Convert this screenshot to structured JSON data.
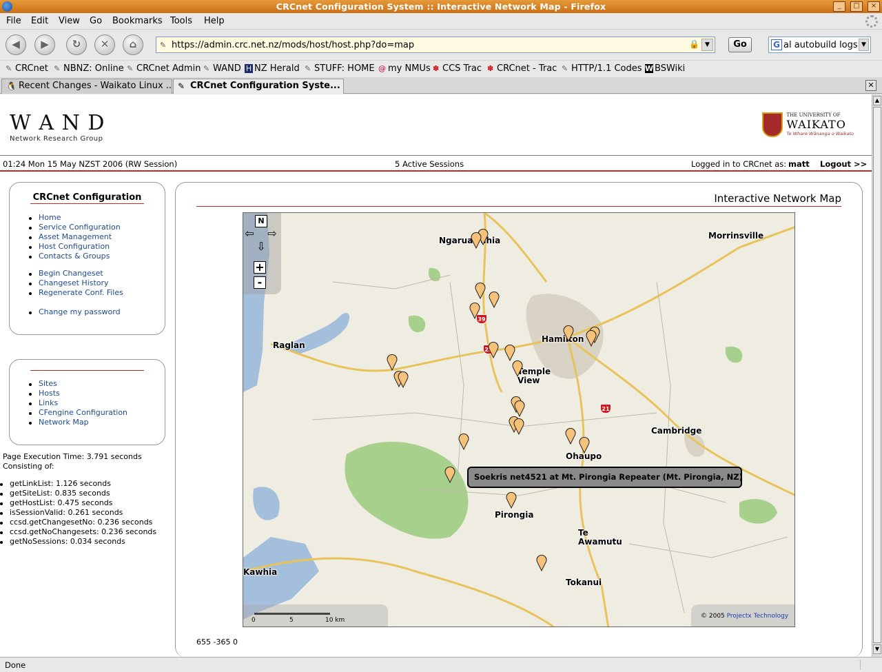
{
  "window": {
    "title": "CRCnet Configuration System :: Interactive Network Map - Firefox",
    "min_glyph": "_",
    "max_glyph": "□",
    "close_glyph": "×"
  },
  "menu": {
    "items": [
      {
        "label": "File"
      },
      {
        "label": "Edit"
      },
      {
        "label": "View"
      },
      {
        "label": "Go"
      },
      {
        "label": "Bookmarks"
      },
      {
        "label": "Tools"
      },
      {
        "label": "Help"
      }
    ]
  },
  "toolbar": {
    "back_glyph": "◀",
    "forward_glyph": "▶",
    "reload_glyph": "↻",
    "stop_glyph": "✕",
    "home_glyph": "⌂",
    "url": "https://admin.crc.net.nz/mods/host/host.php?do=map",
    "go_label": "Go",
    "search_engine_glyph": "G",
    "search_text": "al autobuild logs"
  },
  "bookmarks": [
    {
      "label": "CRCnet",
      "icon": "bookmark-icon"
    },
    {
      "label": "NBNZ: Online",
      "icon": "bookmark-icon"
    },
    {
      "label": "CRCnet Admin",
      "icon": "bookmark-icon"
    },
    {
      "label": "WAND",
      "icon": "bookmark-icon"
    },
    {
      "label": "NZ Herald",
      "icon": "herald-icon"
    },
    {
      "label": "STUFF: HOME",
      "icon": "bookmark-icon"
    },
    {
      "label": "my NMUs",
      "icon": "debian-icon"
    },
    {
      "label": "CCS Trac",
      "icon": "trac-icon"
    },
    {
      "label": "CRCnet - Trac",
      "icon": "trac-icon"
    },
    {
      "label": "HTTP/1.1 Codes",
      "icon": "bookmark-icon"
    },
    {
      "label": "BSWiki",
      "icon": "wiki-icon"
    }
  ],
  "tabs": [
    {
      "label": "Recent Changes - Waikato Linux ..."
    },
    {
      "label": "CRCnet Configuration Syste..."
    }
  ],
  "header": {
    "wand_logo": "W A N D",
    "wand_sub": "Network Research Group",
    "uow_small": "THE UNIVERSITY OF",
    "uow_big": "WAIKATO",
    "uow_motto": "Te Whare Wānanga o Waikato"
  },
  "infobar": {
    "datetime": "01:24 Mon 15 May NZST 2006 (RW Session)",
    "sessions": "5 Active Sessions",
    "logged_in_prefix": "Logged in to CRCnet as:",
    "user": "matt",
    "logout": "Logout >>"
  },
  "sidebar": {
    "config_title": "CRCnet Configuration",
    "group1": [
      "Home",
      "Service Configuration",
      "Asset Management",
      "Host Configuration",
      "Contacts & Groups"
    ],
    "group2": [
      "Begin Changeset",
      "Changeset History",
      "Regenerate Conf. Files"
    ],
    "group3": [
      "Change my password"
    ],
    "group4": [
      "Sites",
      "Hosts",
      "Links",
      "CFengine Configuration",
      "Network Map"
    ]
  },
  "perf": {
    "exec_time": "Page Execution Time: 3.791 seconds",
    "consisting": "Consisting of:",
    "items": [
      "getLinkList: 1.126 seconds",
      "getSiteList: 0.835 seconds",
      "getHostList: 0.475 seconds",
      "isSessionValid: 0.261 seconds",
      "ccsd.getChangesetNo: 0.236 seconds",
      "ccsd.getNoChangesets: 0.236 seconds",
      "getNoSessions: 0.034 seconds"
    ]
  },
  "main": {
    "title": "Interactive Network Map",
    "coords": "655 -365 0"
  },
  "map": {
    "towns": [
      "Ngaruawahia",
      "Morrinsville",
      "Raglan",
      "Hamilton",
      "Temple View",
      "Cambridge",
      "Ohaupo",
      "Pirongia",
      "Te Awamutu",
      "Kawhia",
      "Tokanui"
    ],
    "highways": [
      "39",
      "23",
      "21"
    ],
    "tooltip": "Soekris net4521 at Mt. Pirongia Repeater (Mt. Pirongia, NZ)",
    "scale_labels": [
      "0",
      "5",
      "10 km"
    ],
    "copyright": "© 2005",
    "copyright_link": "Projectx Technology",
    "controls": {
      "north": "N",
      "zoom_in": "+",
      "zoom_out": "-"
    }
  },
  "status": {
    "text": "Done"
  },
  "colors": {
    "accent_red": "#c0282e",
    "link_blue": "#1d4a8e",
    "titlebar_orange": "#d9822b",
    "marker_fill": "#f6c27a",
    "park_green": "#a8d08d",
    "water_blue": "#a4bfdc",
    "road_yellow": "#e8c35a"
  }
}
